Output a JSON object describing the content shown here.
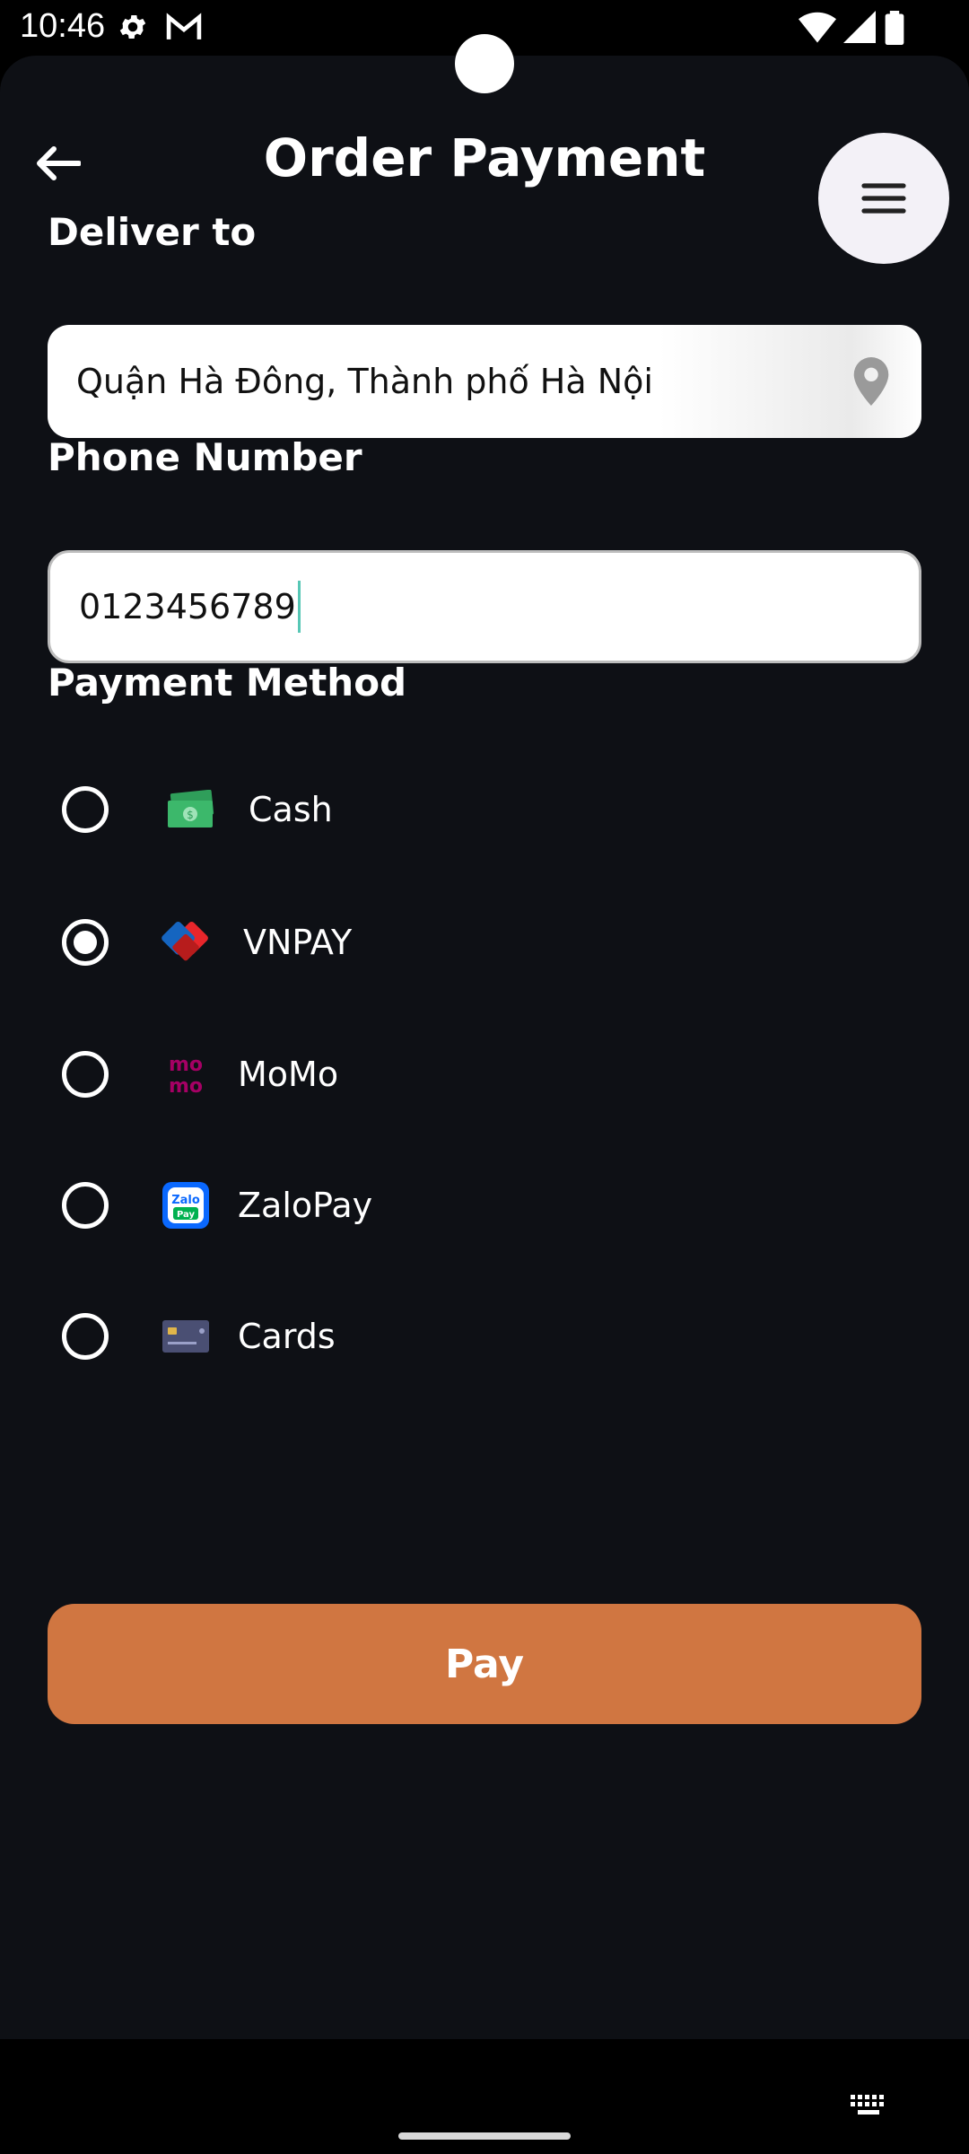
{
  "status_bar": {
    "time": "10:46"
  },
  "header": {
    "title": "Order Payment"
  },
  "deliver": {
    "label": "Deliver to",
    "value": "Quận Hà Đông, Thành phố Hà Nội"
  },
  "phone": {
    "label": "Phone Number",
    "value": "0123456789"
  },
  "payment": {
    "label": "Payment Method",
    "methods": [
      {
        "label": "Cash",
        "selected": false,
        "icon": "cash-icon"
      },
      {
        "label": "VNPAY",
        "selected": true,
        "icon": "vnpay-icon"
      },
      {
        "label": "MoMo",
        "selected": false,
        "icon": "momo-icon"
      },
      {
        "label": "ZaloPay",
        "selected": false,
        "icon": "zalopay-icon"
      },
      {
        "label": "Cards",
        "selected": false,
        "icon": "card-icon"
      }
    ]
  },
  "pay_button": {
    "label": "Pay"
  },
  "colors": {
    "background": "#0e1015",
    "accent": "#d07641",
    "field": "#ffffff"
  }
}
